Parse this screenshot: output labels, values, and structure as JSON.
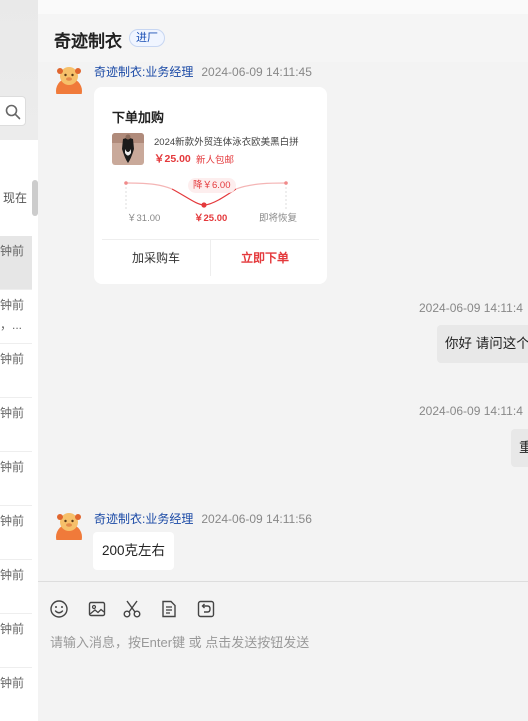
{
  "chat": {
    "title": "奇迹制衣",
    "tag": "进厂"
  },
  "sidebar": {
    "now_label": "现在",
    "items": [
      {
        "time": "钟前",
        "ellipsis": ""
      },
      {
        "time": "钟前",
        "ellipsis": "，..."
      },
      {
        "time": "钟前",
        "ellipsis": ""
      },
      {
        "time": "钟前",
        "ellipsis": ""
      },
      {
        "time": "钟前",
        "ellipsis": ""
      },
      {
        "time": "钟前",
        "ellipsis": ""
      },
      {
        "time": "钟前",
        "ellipsis": ""
      },
      {
        "time": "钟前",
        "ellipsis": ""
      },
      {
        "time": "钟前",
        "ellipsis": ""
      }
    ]
  },
  "messages": {
    "m1": {
      "sender": "奇迹制衣:业务经理",
      "time": "2024-06-09 14:11:45"
    },
    "card": {
      "title": "下单加购",
      "product_name": "2024新款外贸连体泳衣欧美黑白拼",
      "price": "￥25.00",
      "badge": "新人包邮",
      "drop": "降￥6.00",
      "price_old": "￥31.00",
      "price_new": "￥25.00",
      "price_restore": "即将恢复",
      "add_cart": "加采购车",
      "order_now": "立即下单"
    },
    "m2": {
      "time": "2024-06-09 14:11:4",
      "text": "你好 请问这个"
    },
    "m3": {
      "time": "2024-06-09 14:11:4",
      "text": "重"
    },
    "m4": {
      "sender": "奇迹制衣:业务经理",
      "time": "2024-06-09 14:11:56",
      "text": "200克左右"
    }
  },
  "input": {
    "placeholder": "请输入消息，按Enter键 或 点击发送按钮发送",
    "toolbar": [
      "emoji-icon",
      "image-icon",
      "scissors-icon",
      "document-icon",
      "recall-icon"
    ]
  },
  "colors": {
    "accent": "#e4393c",
    "sender": "#1b4aa6",
    "tag": "#1a4fb5"
  },
  "price_trend": {
    "old": 31.0,
    "new": 25.0,
    "drop": 6.0
  }
}
